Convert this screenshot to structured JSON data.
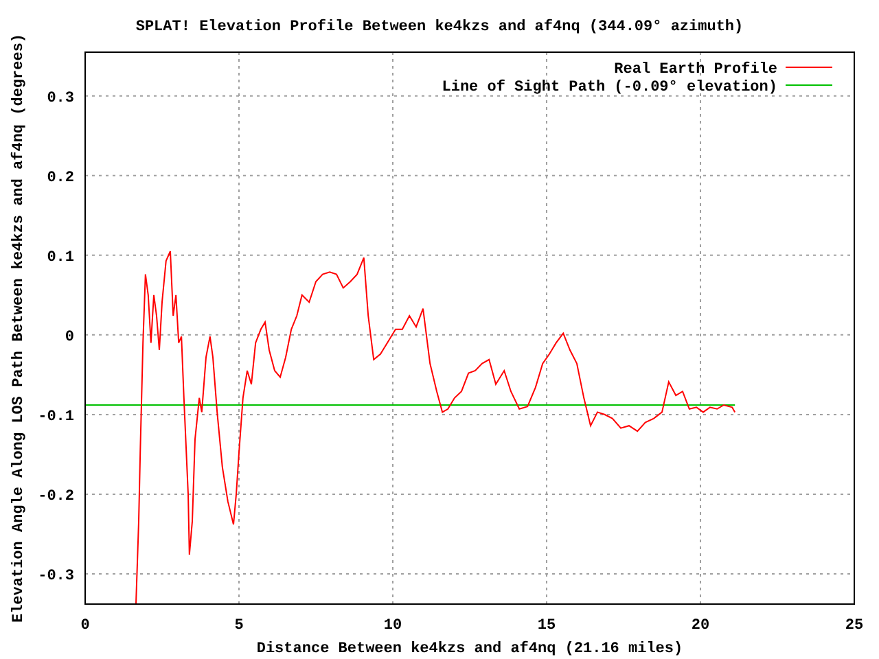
{
  "chart_data": {
    "type": "line",
    "title": "SPLAT! Elevation Profile Between ke4kzs and af4nq (344.09° azimuth)",
    "xlabel": "Distance Between ke4kzs and af4nq (21.16 miles)",
    "ylabel": "Elevation Angle Along LOS Path Between ke4kzs and af4nq (degrees)",
    "x": [
      0,
      1.65,
      1.74,
      1.79,
      1.88,
      1.96,
      2.05,
      2.14,
      2.23,
      2.32,
      2.41,
      2.5,
      2.63,
      2.77,
      2.86,
      2.95,
      3.04,
      3.13,
      3.21,
      3.35,
      3.39,
      3.48,
      3.57,
      3.71,
      3.79,
      3.93,
      4.06,
      4.15,
      4.29,
      4.46,
      4.64,
      4.82,
      4.91,
      5.0,
      5.13,
      5.27,
      5.4,
      5.54,
      5.71,
      5.85,
      5.98,
      6.16,
      6.34,
      6.52,
      6.7,
      6.88,
      7.05,
      7.28,
      7.5,
      7.72,
      7.95,
      8.17,
      8.39,
      8.62,
      8.84,
      9.06,
      9.2,
      9.38,
      9.6,
      9.82,
      10.09,
      10.31,
      10.54,
      10.76,
      10.98,
      11.21,
      11.43,
      11.61,
      11.79,
      12.01,
      12.23,
      12.46,
      12.68,
      12.9,
      13.13,
      13.35,
      13.62,
      13.84,
      14.11,
      14.38,
      14.64,
      14.87,
      15.09,
      15.31,
      15.54,
      15.76,
      15.98,
      16.21,
      16.43,
      16.65,
      16.88,
      17.14,
      17.41,
      17.68,
      17.95,
      18.21,
      18.48,
      18.75,
      18.97,
      19.2,
      19.42,
      19.64,
      19.87,
      20.09,
      20.31,
      20.54,
      20.76,
      21.03,
      21.12
    ],
    "series": [
      {
        "name": "Real Earth Profile",
        "color": "#ff0000",
        "values": [
          null,
          -0.338,
          -0.234,
          -0.148,
          -0.01,
          0.076,
          0.05,
          -0.01,
          0.05,
          0.024,
          -0.019,
          0.041,
          0.093,
          0.105,
          0.024,
          0.05,
          -0.01,
          -0.002,
          -0.079,
          -0.2,
          -0.276,
          -0.234,
          -0.131,
          -0.079,
          -0.097,
          -0.028,
          -0.002,
          -0.028,
          -0.097,
          -0.166,
          -0.209,
          -0.238,
          -0.2,
          -0.148,
          -0.079,
          -0.045,
          -0.062,
          -0.01,
          0.007,
          0.016,
          -0.019,
          -0.045,
          -0.053,
          -0.028,
          0.007,
          0.024,
          0.05,
          0.041,
          0.067,
          0.076,
          0.079,
          0.076,
          0.059,
          0.067,
          0.076,
          0.097,
          0.024,
          -0.031,
          -0.024,
          -0.01,
          0.007,
          0.007,
          0.024,
          0.01,
          0.033,
          -0.036,
          -0.071,
          -0.097,
          -0.093,
          -0.079,
          -0.071,
          -0.048,
          -0.045,
          -0.036,
          -0.031,
          -0.062,
          -0.045,
          -0.071,
          -0.093,
          -0.09,
          -0.066,
          -0.036,
          -0.024,
          -0.01,
          0.002,
          -0.019,
          -0.036,
          -0.079,
          -0.114,
          -0.097,
          -0.1,
          -0.105,
          -0.117,
          -0.114,
          -0.121,
          -0.11,
          -0.105,
          -0.097,
          -0.059,
          -0.076,
          -0.071,
          -0.093,
          -0.091,
          -0.097,
          -0.091,
          -0.093,
          -0.088,
          -0.091,
          -0.097
        ]
      },
      {
        "name": "Line of Sight Path (-0.09° elevation)",
        "color": "#00c000",
        "values": [
          -0.088,
          -0.088,
          -0.088,
          -0.088,
          -0.088,
          -0.088,
          -0.088,
          -0.088,
          -0.088,
          -0.088,
          -0.088,
          -0.088,
          -0.088,
          -0.088,
          -0.088,
          -0.088,
          -0.088,
          -0.088,
          -0.088,
          -0.088,
          -0.088,
          -0.088,
          -0.088,
          -0.088,
          -0.088,
          -0.088,
          -0.088,
          -0.088,
          -0.088,
          -0.088,
          -0.088,
          -0.088,
          -0.088,
          -0.088,
          -0.088,
          -0.088,
          -0.088,
          -0.088,
          -0.088,
          -0.088,
          -0.088,
          -0.088,
          -0.088,
          -0.088,
          -0.088,
          -0.088,
          -0.088,
          -0.088,
          -0.088,
          -0.088,
          -0.088,
          -0.088,
          -0.088,
          -0.088,
          -0.088,
          -0.088,
          -0.088,
          -0.088,
          -0.088,
          -0.088,
          -0.088,
          -0.088,
          -0.088,
          -0.088,
          -0.088,
          -0.088,
          -0.088,
          -0.088,
          -0.088,
          -0.088,
          -0.088,
          -0.088,
          -0.088,
          -0.088,
          -0.088,
          -0.088,
          -0.088,
          -0.088,
          -0.088,
          -0.088,
          -0.088,
          -0.088,
          -0.088,
          -0.088,
          -0.088,
          -0.088,
          -0.088,
          -0.088,
          -0.088,
          -0.088,
          -0.088,
          -0.088,
          -0.088,
          -0.088,
          -0.088,
          -0.088,
          -0.088,
          -0.088,
          -0.088,
          -0.088,
          -0.088,
          -0.088,
          -0.088,
          -0.088,
          -0.088,
          -0.088,
          -0.088,
          -0.088,
          -0.088
        ]
      }
    ],
    "grid": true,
    "legend": true,
    "xlim": [
      0,
      25
    ],
    "ylim": [
      -0.338,
      0.355
    ],
    "xticks": [
      0,
      5,
      10,
      15,
      20,
      25
    ],
    "yticks": [
      -0.3,
      -0.2,
      -0.1,
      0,
      0.1,
      0.2,
      0.3
    ]
  }
}
